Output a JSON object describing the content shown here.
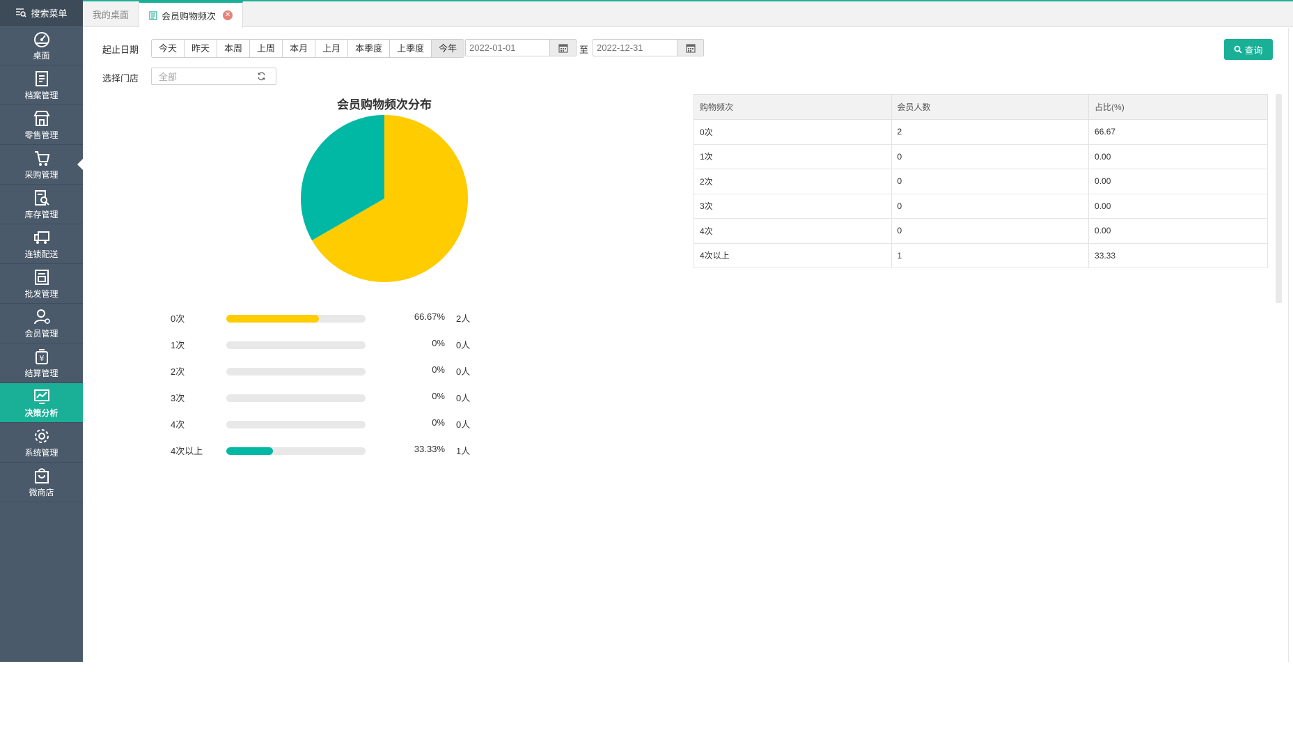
{
  "sidebar": {
    "search_label": "搜索菜单",
    "items": [
      {
        "label": "桌面",
        "icon": "dashboard-icon"
      },
      {
        "label": "档案管理",
        "icon": "archive-icon"
      },
      {
        "label": "零售管理",
        "icon": "store-icon"
      },
      {
        "label": "采购管理",
        "icon": "purchase-icon"
      },
      {
        "label": "库存管理",
        "icon": "inventory-icon"
      },
      {
        "label": "连锁配送",
        "icon": "delivery-icon"
      },
      {
        "label": "批发管理",
        "icon": "wholesale-icon"
      },
      {
        "label": "会员管理",
        "icon": "member-icon"
      },
      {
        "label": "结算管理",
        "icon": "settlement-icon"
      },
      {
        "label": "决策分析",
        "icon": "analysis-icon",
        "active": true
      },
      {
        "label": "系统管理",
        "icon": "settings-icon"
      },
      {
        "label": "微商店",
        "icon": "shop-bag-icon"
      }
    ]
  },
  "tabs": [
    {
      "label": "我的桌面"
    },
    {
      "label": "会员购物频次",
      "active": true
    }
  ],
  "filters": {
    "date_label": "起止日期",
    "date_buttons": [
      "今天",
      "昨天",
      "本周",
      "上周",
      "本月",
      "上月",
      "本季度",
      "上季度",
      "今年"
    ],
    "active_button": "今年",
    "start_date": "2022-01-01",
    "separator": "至",
    "end_date": "2022-12-31",
    "store_label": "选择门店",
    "store_value": "全部",
    "query_label": "查询"
  },
  "chart_data": {
    "type": "pie",
    "title": "会员购物频次分布",
    "categories": [
      "0次",
      "1次",
      "2次",
      "3次",
      "4次",
      "4次以上"
    ],
    "values": [
      66.67,
      0,
      0,
      0,
      0,
      33.33
    ],
    "counts": [
      "2人",
      "0人",
      "0人",
      "0人",
      "0人",
      "1人"
    ],
    "percent_labels": [
      "66.67%",
      "0%",
      "0%",
      "0%",
      "0%",
      "33.33%"
    ],
    "colors": [
      "#ffcc00",
      "#ffcc00",
      "#ffcc00",
      "#ffcc00",
      "#ffcc00",
      "#00b8a4"
    ]
  },
  "table": {
    "headers": [
      "购物频次",
      "会员人数",
      "占比(%)"
    ],
    "rows": [
      [
        "0次",
        "2",
        "66.67"
      ],
      [
        "1次",
        "0",
        "0.00"
      ],
      [
        "2次",
        "0",
        "0.00"
      ],
      [
        "3次",
        "0",
        "0.00"
      ],
      [
        "4次",
        "0",
        "0.00"
      ],
      [
        "4次以上",
        "1",
        "33.33"
      ]
    ]
  }
}
